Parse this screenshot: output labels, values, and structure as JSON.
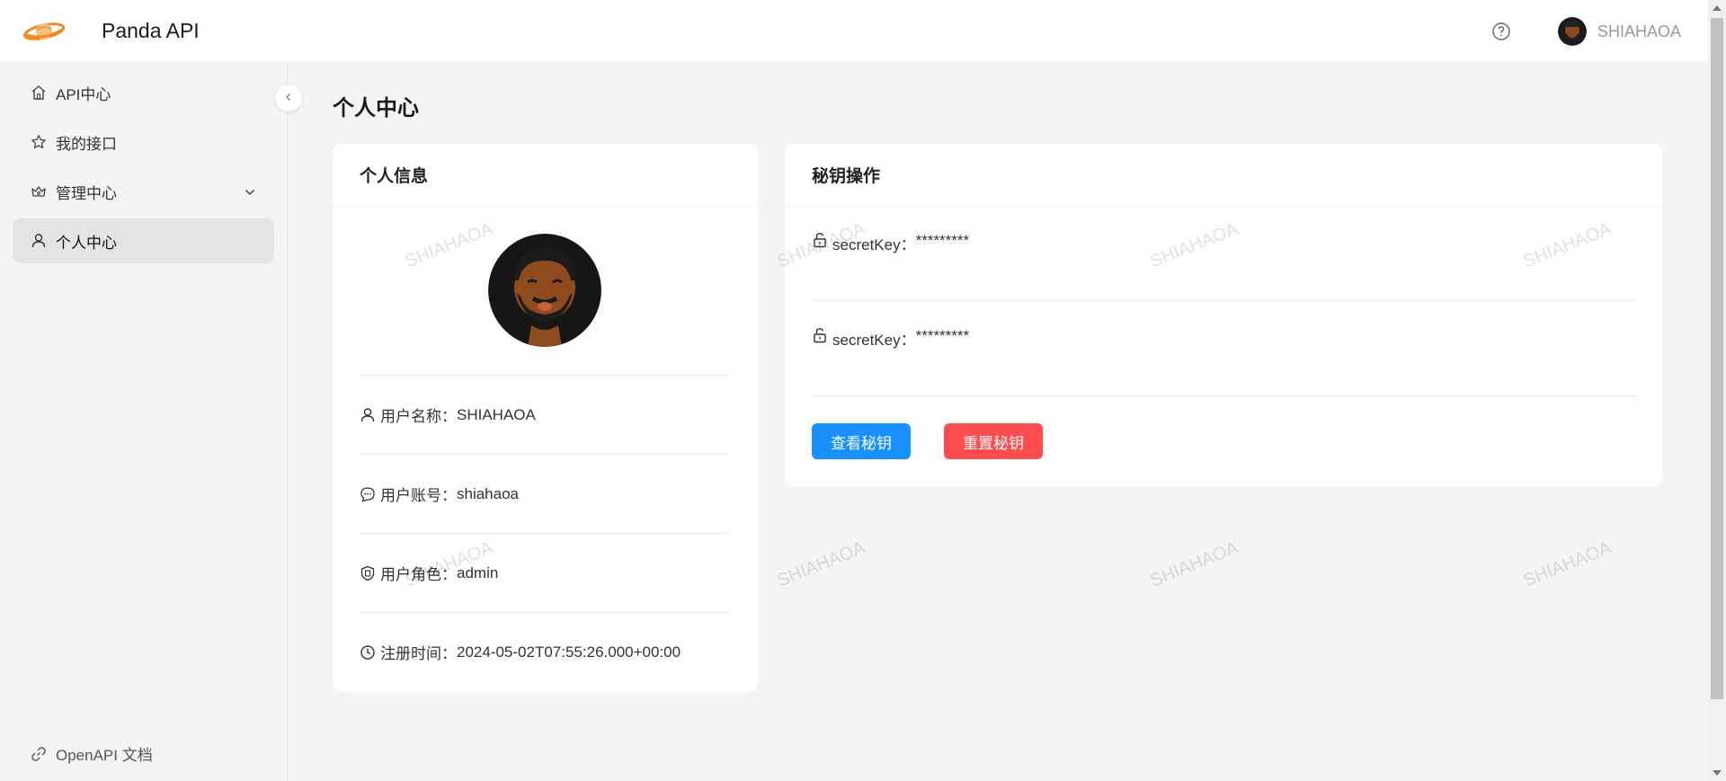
{
  "header": {
    "app_title": "Panda API",
    "user_name": "SHIAHAOA"
  },
  "sidebar": {
    "items": [
      {
        "label": "API中心",
        "icon": "home-icon"
      },
      {
        "label": "我的接口",
        "icon": "star-icon"
      },
      {
        "label": "管理中心",
        "icon": "crown-icon"
      },
      {
        "label": "个人中心",
        "icon": "user-icon"
      }
    ],
    "footer_link": "OpenAPI 文档"
  },
  "page": {
    "title": "个人中心"
  },
  "info_card": {
    "title": "个人信息",
    "rows": [
      {
        "label": "用户名称：",
        "value": "SHIAHAOA"
      },
      {
        "label": "用户账号：",
        "value": "shiahaoa"
      },
      {
        "label": "用户角色：",
        "value": "admin"
      },
      {
        "label": "注册时间：",
        "value": "2024-05-02T07:55:26.000+00:00"
      }
    ]
  },
  "key_card": {
    "title": "秘钥操作",
    "rows": [
      {
        "label": "secretKey：",
        "value": "*********"
      },
      {
        "label": "secretKey：",
        "value": "*********"
      }
    ],
    "view_button": "查看秘钥",
    "reset_button": "重置秘钥"
  },
  "watermark": "SHIAHAOA",
  "colors": {
    "primary": "#1890ff",
    "danger": "#ff4d4f"
  }
}
